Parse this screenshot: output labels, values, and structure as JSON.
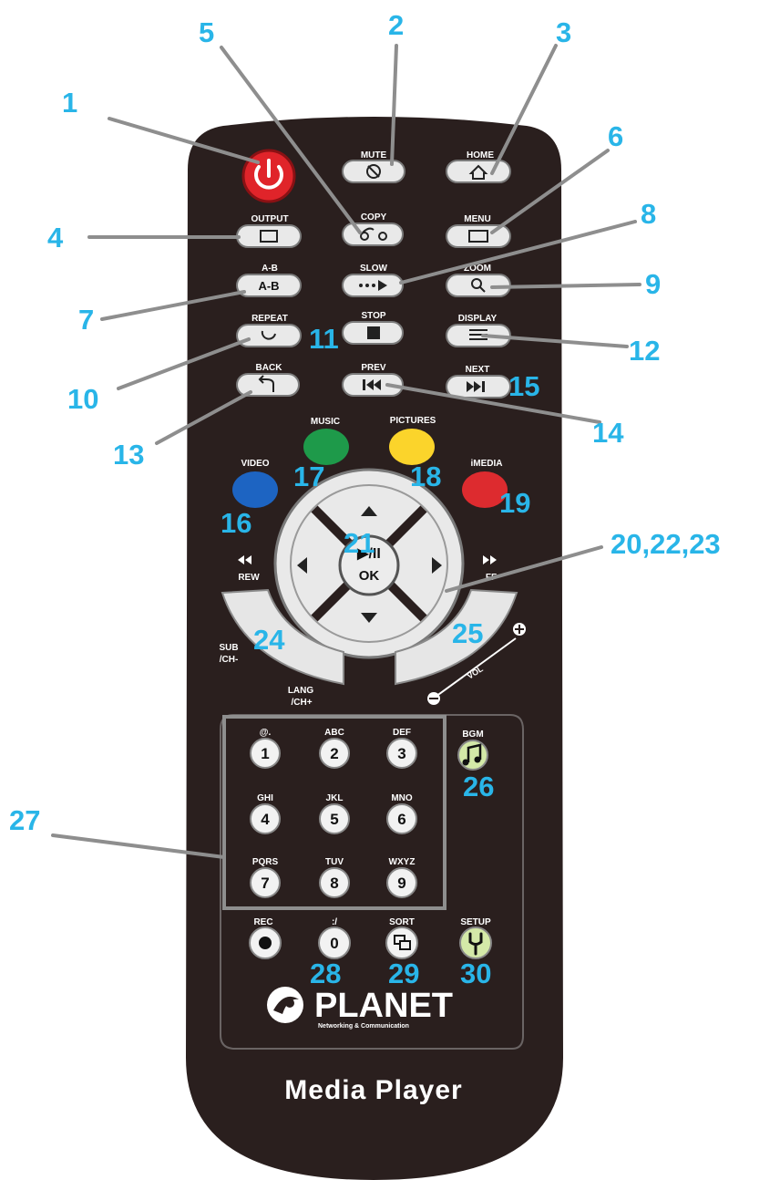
{
  "buttons": {
    "mute": "MUTE",
    "home": "HOME",
    "output": "OUTPUT",
    "copy": "COPY",
    "menu": "MENU",
    "ab_top": "A-B",
    "ab_face": "A-B",
    "slow": "SLOW",
    "zoom": "ZOOM",
    "repeat": "REPEAT",
    "stop": "STOP",
    "display": "DISPLAY",
    "back": "BACK",
    "prev": "PREV",
    "next": "NEXT",
    "music": "MUSIC",
    "pictures": "PICTURES",
    "video": "VIDEO",
    "imedia": "iMEDIA",
    "ok_symbol": "▶/II",
    "ok": "OK",
    "rew": "REW",
    "ff": "FF",
    "sub": "SUB",
    "ch_minus": "/CH-",
    "lang": "LANG",
    "ch_plus": "/CH+",
    "vol": "VOL",
    "bgm": "BGM",
    "rec": "REC",
    "slash": ":/",
    "sort": "SORT",
    "setup": "SETUP"
  },
  "keypad": [
    {
      "letters": "@.",
      "digit": "1"
    },
    {
      "letters": "ABC",
      "digit": "2"
    },
    {
      "letters": "DEF",
      "digit": "3"
    },
    {
      "letters": "GHI",
      "digit": "4"
    },
    {
      "letters": "JKL",
      "digit": "5"
    },
    {
      "letters": "MNO",
      "digit": "6"
    },
    {
      "letters": "PQRS",
      "digit": "7"
    },
    {
      "letters": "TUV",
      "digit": "8"
    },
    {
      "letters": "WXYZ",
      "digit": "9"
    }
  ],
  "zero_digit": "0",
  "brand": {
    "name": "PLANET",
    "tagline": "Networking & Communication",
    "product": "Media Player"
  },
  "callouts": {
    "c1": "1",
    "c2": "2",
    "c3": "3",
    "c4": "4",
    "c5": "5",
    "c6": "6",
    "c7": "7",
    "c8": "8",
    "c9": "9",
    "c10": "10",
    "c11": "11",
    "c12": "12",
    "c13": "13",
    "c14": "14",
    "c15": "15",
    "c16": "16",
    "c17": "17",
    "c18": "18",
    "c19": "19",
    "c20": "20,22,23",
    "c21": "21",
    "c24": "24",
    "c25": "25",
    "c26": "26",
    "c27": "27",
    "c28": "28",
    "c29": "29",
    "c30": "30"
  },
  "colors": {
    "body": "#2a1f1e",
    "power": "#e0242a",
    "music": "#1e9a4a",
    "pictures": "#fbd42b",
    "video": "#1d64c2",
    "imedia": "#dd2b2f",
    "callout": "#29b5e8"
  }
}
